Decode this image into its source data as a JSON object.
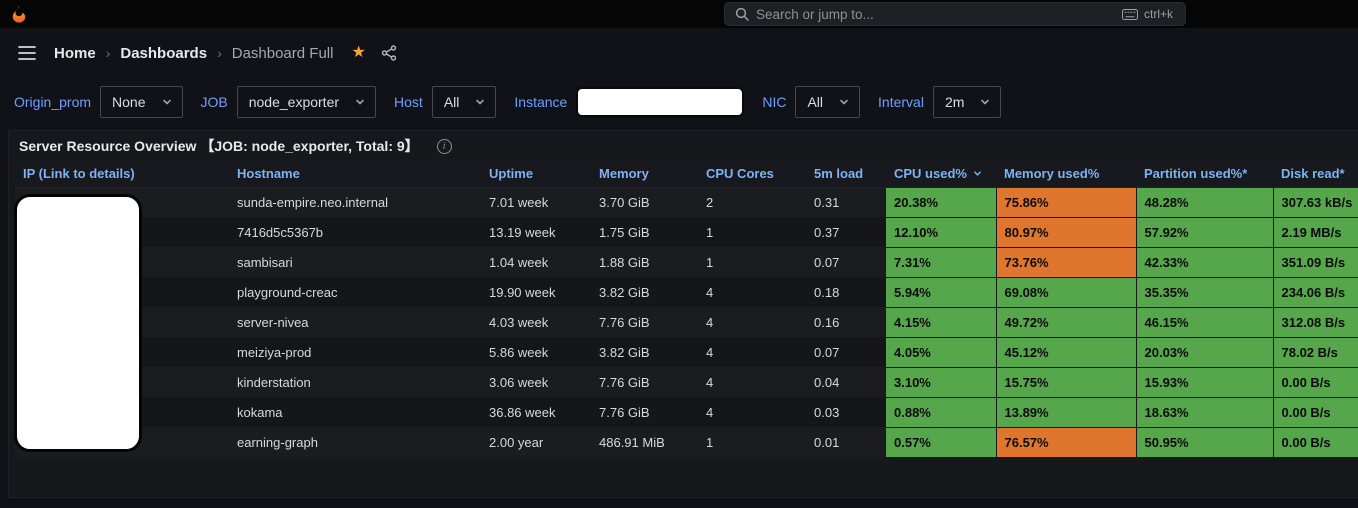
{
  "colors": {
    "green": "#56a64b",
    "orange": "#e0752d",
    "link_blue": "#6e9fff",
    "header_blue": "#7eb2f2",
    "star_yellow": "#f2a72e",
    "brand_orange": "#f05a28"
  },
  "topbar": {
    "search_placeholder": "Search or jump to...",
    "shortcut": "ctrl+k"
  },
  "breadcrumb": {
    "home": "Home",
    "section": "Dashboards",
    "current": "Dashboard Full"
  },
  "filters": [
    {
      "label": "Origin_prom",
      "value": "None",
      "redacted": false
    },
    {
      "label": "JOB",
      "value": "node_exporter",
      "redacted": false
    },
    {
      "label": "Host",
      "value": "All",
      "redacted": false
    },
    {
      "label": "Instance",
      "value": "",
      "redacted": true
    },
    {
      "label": "NIC",
      "value": "All",
      "redacted": false
    },
    {
      "label": "Interval",
      "value": "2m",
      "redacted": false
    }
  ],
  "panel": {
    "title": "Server Resource Overview 【JOB: node_exporter, Total: 9】"
  },
  "table": {
    "columns": [
      {
        "label": "IP  (Link to details)"
      },
      {
        "label": "Hostname"
      },
      {
        "label": "Uptime"
      },
      {
        "label": "Memory"
      },
      {
        "label": "CPU Cores"
      },
      {
        "label": "5m load"
      },
      {
        "label": "CPU used%",
        "sorted": true
      },
      {
        "label": "Memory used%"
      },
      {
        "label": "Partition used%*"
      },
      {
        "label": "Disk read*"
      }
    ],
    "rows": [
      {
        "hostname": "sunda-empire.neo.internal",
        "uptime": "7.01 week",
        "memory": "3.70 GiB",
        "cores": "2",
        "load": "0.31",
        "cpu": {
          "value": "20.38%",
          "color": "green"
        },
        "mem": {
          "value": "75.86%",
          "color": "orange"
        },
        "partition": {
          "value": "48.28%",
          "color": "green"
        },
        "disk": {
          "value": "307.63 kB/s",
          "color": "green"
        }
      },
      {
        "hostname": "7416d5c5367b",
        "uptime": "13.19 week",
        "memory": "1.75 GiB",
        "cores": "1",
        "load": "0.37",
        "cpu": {
          "value": "12.10%",
          "color": "green"
        },
        "mem": {
          "value": "80.97%",
          "color": "orange"
        },
        "partition": {
          "value": "57.92%",
          "color": "green"
        },
        "disk": {
          "value": "2.19 MB/s",
          "color": "green"
        }
      },
      {
        "hostname": "sambisari",
        "uptime": "1.04 week",
        "memory": "1.88 GiB",
        "cores": "1",
        "load": "0.07",
        "cpu": {
          "value": "7.31%",
          "color": "green"
        },
        "mem": {
          "value": "73.76%",
          "color": "orange"
        },
        "partition": {
          "value": "42.33%",
          "color": "green"
        },
        "disk": {
          "value": "351.09 B/s",
          "color": "green"
        }
      },
      {
        "hostname": "playground-creac",
        "uptime": "19.90 week",
        "memory": "3.82 GiB",
        "cores": "4",
        "load": "0.18",
        "cpu": {
          "value": "5.94%",
          "color": "green"
        },
        "mem": {
          "value": "69.08%",
          "color": "green"
        },
        "partition": {
          "value": "35.35%",
          "color": "green"
        },
        "disk": {
          "value": "234.06 B/s",
          "color": "green"
        }
      },
      {
        "hostname": "server-nivea",
        "uptime": "4.03 week",
        "memory": "7.76 GiB",
        "cores": "4",
        "load": "0.16",
        "cpu": {
          "value": "4.15%",
          "color": "green"
        },
        "mem": {
          "value": "49.72%",
          "color": "green"
        },
        "partition": {
          "value": "46.15%",
          "color": "green"
        },
        "disk": {
          "value": "312.08 B/s",
          "color": "green"
        }
      },
      {
        "hostname": "meiziya-prod",
        "uptime": "5.86 week",
        "memory": "3.82 GiB",
        "cores": "4",
        "load": "0.07",
        "cpu": {
          "value": "4.05%",
          "color": "green"
        },
        "mem": {
          "value": "45.12%",
          "color": "green"
        },
        "partition": {
          "value": "20.03%",
          "color": "green"
        },
        "disk": {
          "value": "78.02 B/s",
          "color": "green"
        }
      },
      {
        "hostname": "kinderstation",
        "uptime": "3.06 week",
        "memory": "7.76 GiB",
        "cores": "4",
        "load": "0.04",
        "cpu": {
          "value": "3.10%",
          "color": "green"
        },
        "mem": {
          "value": "15.75%",
          "color": "green"
        },
        "partition": {
          "value": "15.93%",
          "color": "green"
        },
        "disk": {
          "value": "0.00 B/s",
          "color": "green"
        }
      },
      {
        "hostname": "kokama",
        "uptime": "36.86 week",
        "memory": "7.76 GiB",
        "cores": "4",
        "load": "0.03",
        "cpu": {
          "value": "0.88%",
          "color": "green"
        },
        "mem": {
          "value": "13.89%",
          "color": "green"
        },
        "partition": {
          "value": "18.63%",
          "color": "green"
        },
        "disk": {
          "value": "0.00 B/s",
          "color": "green"
        }
      },
      {
        "hostname": "earning-graph",
        "uptime": "2.00 year",
        "memory": "486.91 MiB",
        "cores": "1",
        "load": "0.01",
        "cpu": {
          "value": "0.57%",
          "color": "green"
        },
        "mem": {
          "value": "76.57%",
          "color": "orange"
        },
        "partition": {
          "value": "50.95%",
          "color": "green"
        },
        "disk": {
          "value": "0.00 B/s",
          "color": "green"
        }
      }
    ]
  }
}
